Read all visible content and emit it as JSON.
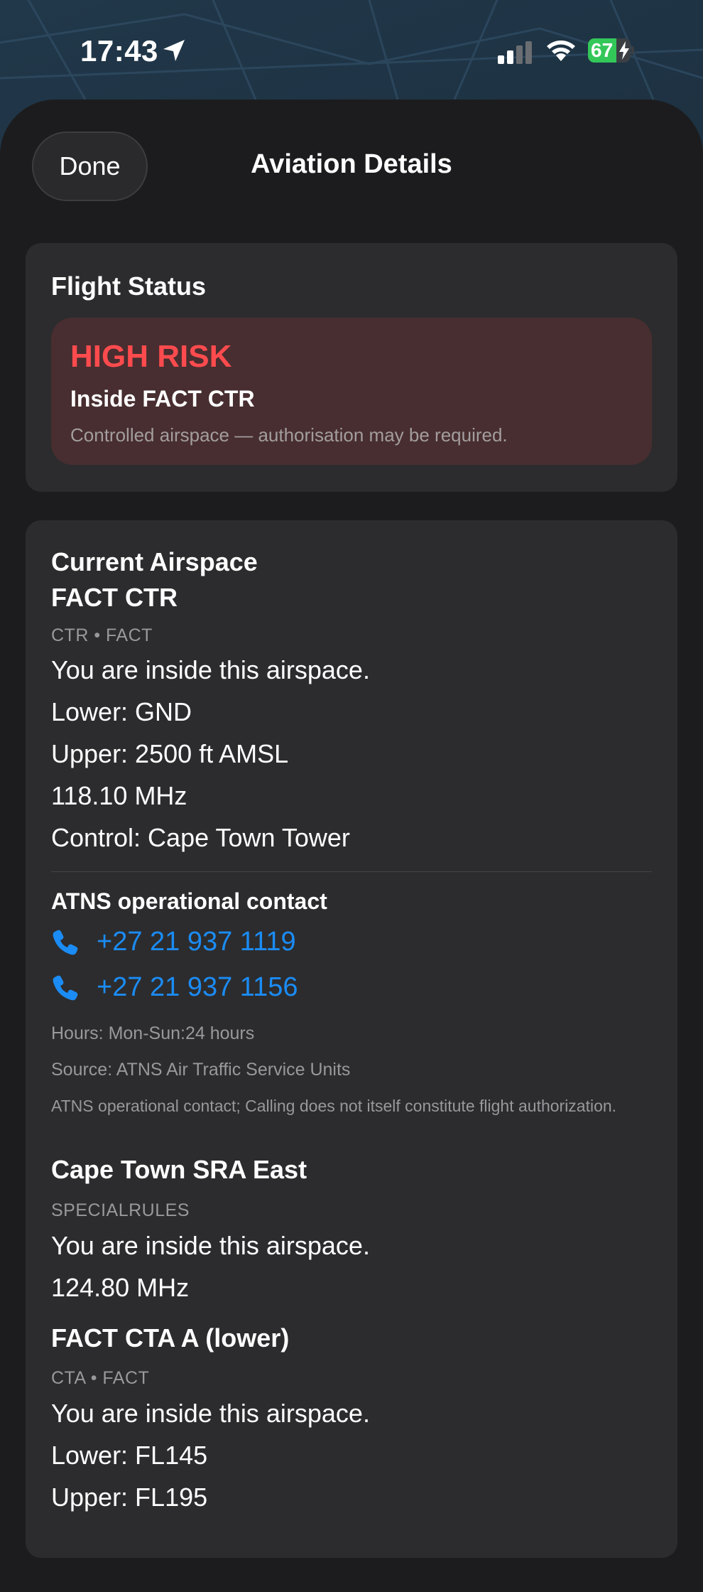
{
  "status_bar": {
    "time": "17:43",
    "battery": "67",
    "battery_level": 0.67
  },
  "header": {
    "done_label": "Done",
    "title": "Aviation Details"
  },
  "flight_status": {
    "heading": "Flight Status",
    "risk_level": "HIGH RISK",
    "risk_title": "Inside FACT CTR",
    "risk_description": "Controlled airspace — authorisation may be required."
  },
  "current_airspace": {
    "heading": "Current Airspace",
    "zones": [
      {
        "name": "FACT CTR",
        "sub": "CTR • FACT",
        "lines": [
          "You are inside this airspace.",
          "Lower: GND",
          "Upper: 2500 ft AMSL",
          "118.10 MHz",
          "Control: Cape Town Tower"
        ]
      },
      {
        "name": "Cape Town SRA East",
        "sub": "SPECIALRULES",
        "lines": [
          "You are inside this airspace.",
          "124.80 MHz"
        ]
      },
      {
        "name": "FACT CTA A (lower)",
        "sub": "CTA • FACT",
        "lines": [
          "You are inside this airspace.",
          "Lower: FL145",
          "Upper: FL195"
        ]
      }
    ],
    "contact": {
      "heading": "ATNS operational contact",
      "phones": [
        "+27 21 937 1119",
        "+27 21 937 1156"
      ],
      "hours": "Hours: Mon-Sun:24 hours",
      "source": "Source: ATNS Air Traffic Service Units",
      "note": "ATNS operational contact; Calling does not itself constitute flight authorization."
    }
  },
  "colors": {
    "risk_red": "#ff4b4e",
    "link_blue": "#1b8cf5",
    "battery_green": "#33c759"
  }
}
